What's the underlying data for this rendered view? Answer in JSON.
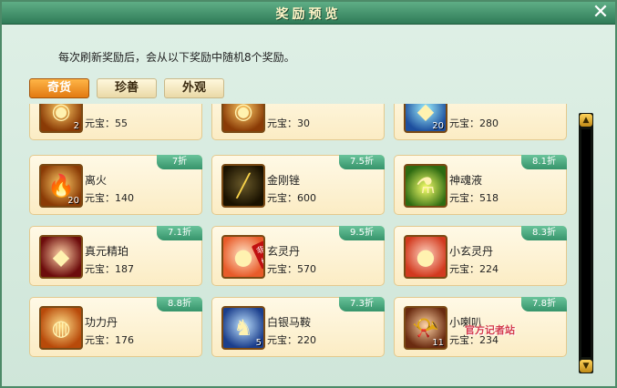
{
  "window": {
    "title": "奖励预览"
  },
  "description": "每次刷新奖励后，会从以下奖励中随机8个奖励。",
  "tabs": [
    {
      "label": "奇货",
      "active": true
    },
    {
      "label": "珍善",
      "active": false
    },
    {
      "label": "外观",
      "active": false
    }
  ],
  "items": [
    {
      "name": "",
      "price": "元宝：55",
      "count": "2",
      "discount": "",
      "icon": "gold-ingot-icon"
    },
    {
      "name": "",
      "price": "元宝：30",
      "count": "",
      "discount": "",
      "icon": "gold-ingot-icon"
    },
    {
      "name": "",
      "price": "元宝：280",
      "count": "20",
      "discount": "",
      "icon": "blue-crystal-icon"
    },
    {
      "name": "离火",
      "price": "元宝：140",
      "count": "20",
      "discount": "7折",
      "icon": "fire-icon"
    },
    {
      "name": "金刚锉",
      "price": "元宝：600",
      "count": "",
      "discount": "7.5折",
      "icon": "golden-file-icon"
    },
    {
      "name": "神魂液",
      "price": "元宝：518",
      "count": "",
      "discount": "8.1折",
      "icon": "potion-icon"
    },
    {
      "name": "真元精珀",
      "price": "元宝：187",
      "count": "",
      "discount": "7.1折",
      "icon": "red-gem-icon"
    },
    {
      "name": "玄灵丹",
      "price": "元宝：570",
      "count": "",
      "discount": "9.5折",
      "icon": "pill-icon",
      "stamp": "非绑"
    },
    {
      "name": "小玄灵丹",
      "price": "元宝：224",
      "count": "",
      "discount": "8.3折",
      "icon": "pill-icon"
    },
    {
      "name": "功力丹",
      "price": "元宝：176",
      "count": "",
      "discount": "8.8折",
      "icon": "orange-pill-icon"
    },
    {
      "name": "白银马鞍",
      "price": "元宝：220",
      "count": "5",
      "discount": "7.3折",
      "icon": "saddle-icon"
    },
    {
      "name": "小喇叭",
      "price": "元宝：234",
      "count": "11",
      "discount": "7.8折",
      "icon": "horn-icon"
    }
  ],
  "watermark": "官方记者站"
}
